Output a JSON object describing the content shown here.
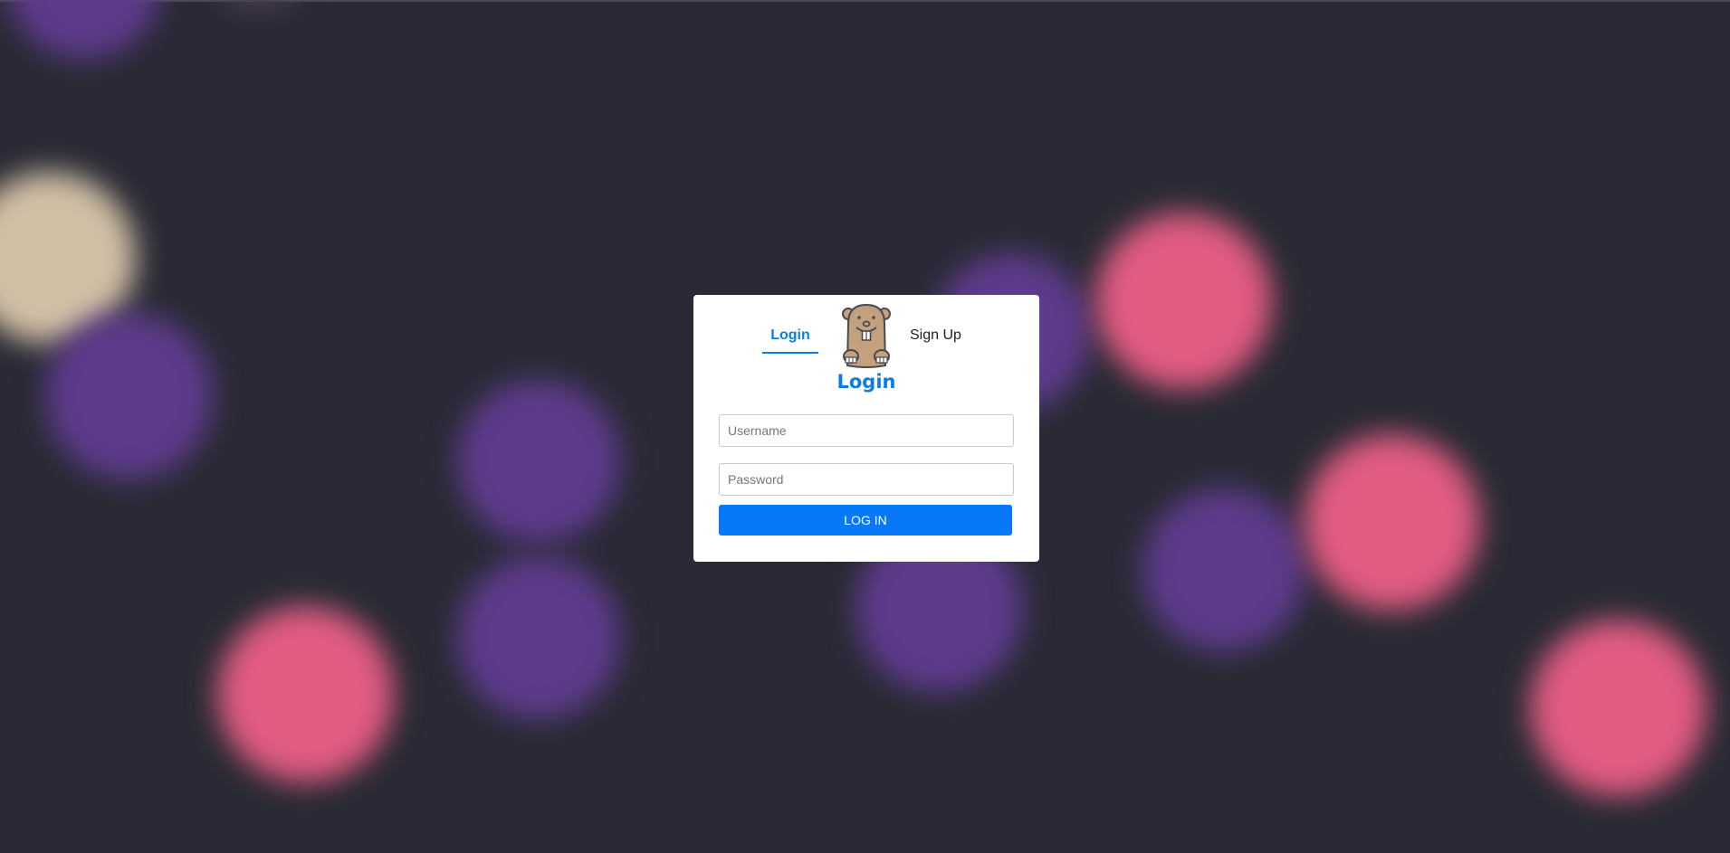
{
  "tabs": {
    "login_label": "Login",
    "signup_label": "Sign Up",
    "active": "login"
  },
  "form": {
    "title": "Login",
    "username_placeholder": "Username",
    "password_placeholder": "Password",
    "submit_label": "LOG IN"
  },
  "mascot": {
    "icon": "beaver-icon"
  },
  "colors": {
    "accent": "#0b7ee6",
    "button": "#0779f6",
    "background": "#292a35",
    "card": "#ffffff"
  }
}
